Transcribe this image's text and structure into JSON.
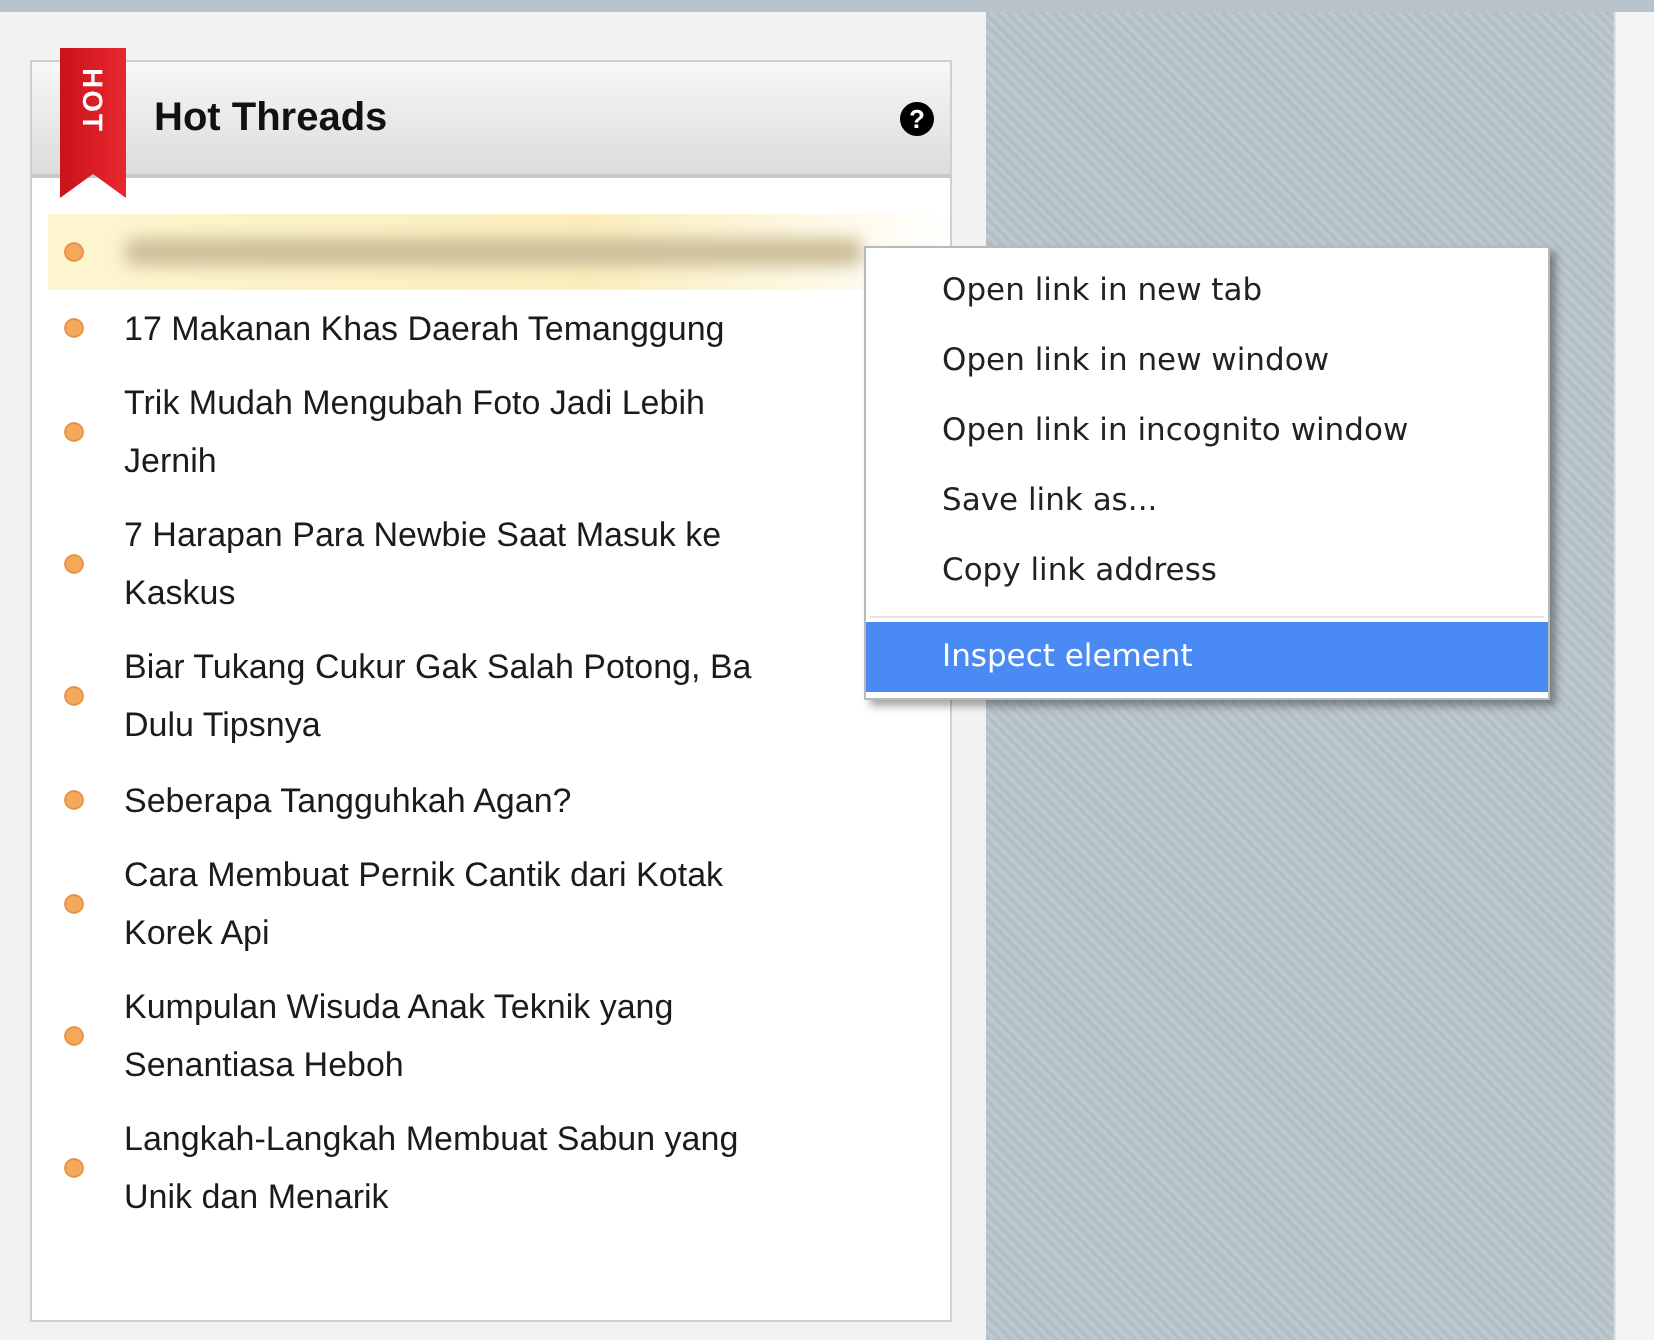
{
  "widget": {
    "ribbon": "HOT",
    "title": "Hot Threads",
    "help": "?"
  },
  "threads": [
    {
      "kind": "redacted",
      "hovered": true
    },
    {
      "kind": "link",
      "hovered": false,
      "lines": [
        "17 Makanan Khas Daerah Temanggung"
      ]
    },
    {
      "kind": "link",
      "hovered": false,
      "lines": [
        "Trik Mudah Mengubah Foto Jadi Lebih",
        "Jernih"
      ]
    },
    {
      "kind": "link",
      "hovered": false,
      "lines": [
        "7 Harapan Para Newbie Saat Masuk ke",
        "Kaskus"
      ]
    },
    {
      "kind": "link",
      "hovered": false,
      "lines": [
        "Biar Tukang Cukur Gak Salah Potong, Ba",
        "Dulu Tipsnya"
      ]
    },
    {
      "kind": "link",
      "hovered": false,
      "lines": [
        "Seberapa Tangguhkah Agan?"
      ]
    },
    {
      "kind": "link",
      "hovered": false,
      "lines": [
        "Cara Membuat Pernik Cantik dari Kotak",
        "Korek Api"
      ]
    },
    {
      "kind": "link",
      "hovered": false,
      "lines": [
        "Kumpulan Wisuda Anak Teknik yang",
        "Senantiasa Heboh"
      ]
    },
    {
      "kind": "link",
      "hovered": false,
      "lines": [
        "Langkah-Langkah Membuat Sabun yang",
        "Unik dan Menarik"
      ]
    }
  ],
  "context_menu": {
    "items": [
      {
        "label": "Open link in new tab",
        "selected": false,
        "separator_before": false
      },
      {
        "label": "Open link in new window",
        "selected": false,
        "separator_before": false
      },
      {
        "label": "Open link in incognito window",
        "selected": false,
        "separator_before": false
      },
      {
        "label": "Save link as...",
        "selected": false,
        "separator_before": false
      },
      {
        "label": "Copy link address",
        "selected": false,
        "separator_before": false
      },
      {
        "label": "Inspect element",
        "selected": true,
        "separator_before": true
      }
    ]
  }
}
